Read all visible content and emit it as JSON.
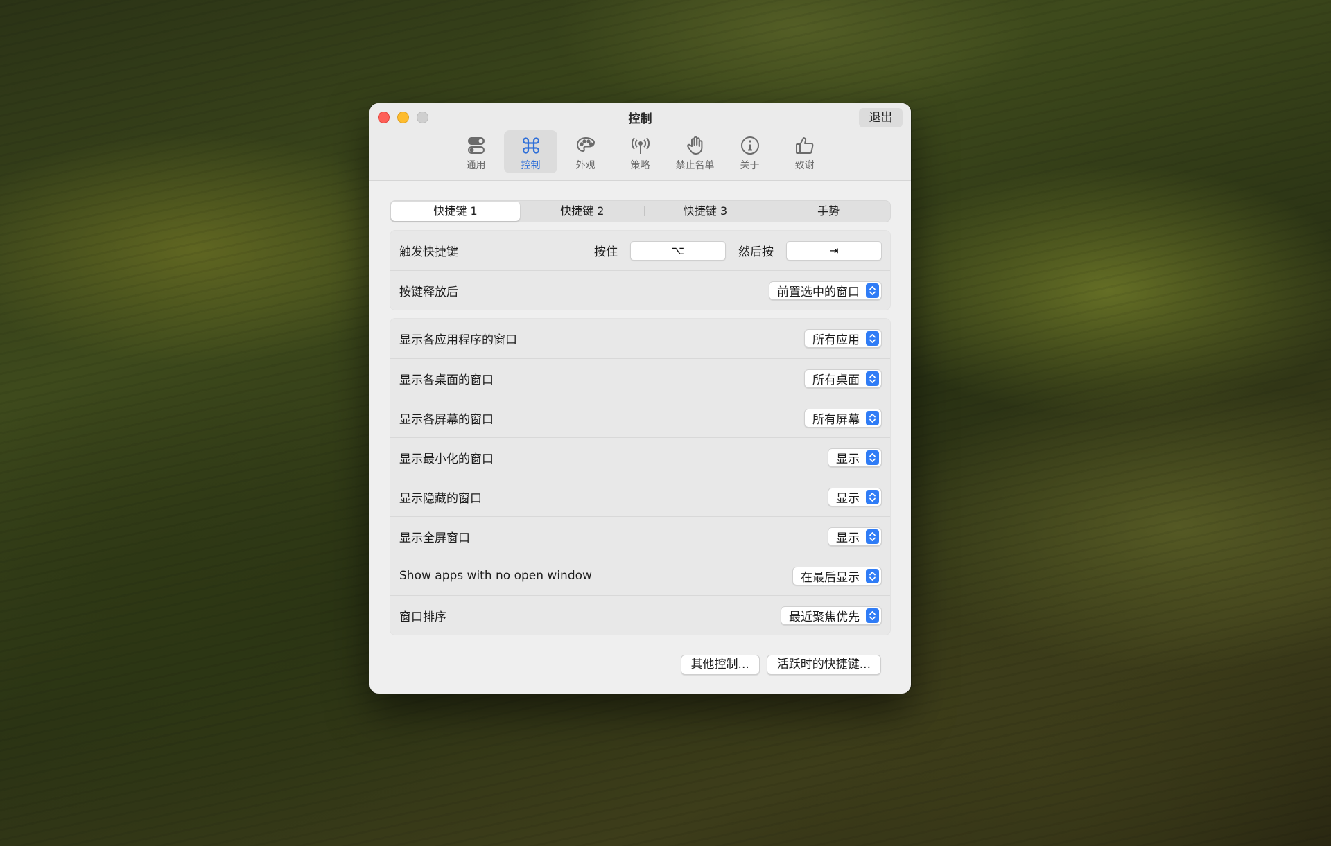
{
  "window": {
    "title": "控制",
    "quit_label": "退出"
  },
  "toolbar": {
    "items": [
      {
        "label": "通用",
        "icon": "toggle-icon"
      },
      {
        "label": "控制",
        "icon": "command-icon"
      },
      {
        "label": "外观",
        "icon": "palette-icon"
      },
      {
        "label": "策略",
        "icon": "antenna-icon"
      },
      {
        "label": "禁止名单",
        "icon": "hand-icon"
      },
      {
        "label": "关于",
        "icon": "info-icon"
      },
      {
        "label": "致谢",
        "icon": "thumbs-up-icon"
      }
    ],
    "active_index": 1
  },
  "tabs": {
    "items": [
      "快捷键 1",
      "快捷键 2",
      "快捷键 3",
      "手势"
    ],
    "active_index": 0
  },
  "shortcut_group": {
    "trigger": {
      "label": "触发快捷键",
      "hold_label": "按住",
      "hold_key": "⌥",
      "then_label": "然后按",
      "then_key": "⇥"
    },
    "release": {
      "label": "按键释放后",
      "value": "前置选中的窗口"
    }
  },
  "filter_group": {
    "rows": [
      {
        "label": "显示各应用程序的窗口",
        "value": "所有应用"
      },
      {
        "label": "显示各桌面的窗口",
        "value": "所有桌面"
      },
      {
        "label": "显示各屏幕的窗口",
        "value": "所有屏幕"
      },
      {
        "label": "显示最小化的窗口",
        "value": "显示"
      },
      {
        "label": "显示隐藏的窗口",
        "value": "显示"
      },
      {
        "label": "显示全屏窗口",
        "value": "显示"
      },
      {
        "label": "Show apps with no open window",
        "value": "在最后显示"
      },
      {
        "label": "窗口排序",
        "value": "最近聚焦优先"
      }
    ]
  },
  "buttons": {
    "other_controls": "其他控制...",
    "active_shortcuts": "活跃时的快捷键..."
  },
  "colors": {
    "accent": "#2f7cf6",
    "active_tool": "#2f6fd8",
    "close": "#fe5f57",
    "minimize": "#febc2e",
    "zoom_inactive": "#cfcfcf"
  }
}
